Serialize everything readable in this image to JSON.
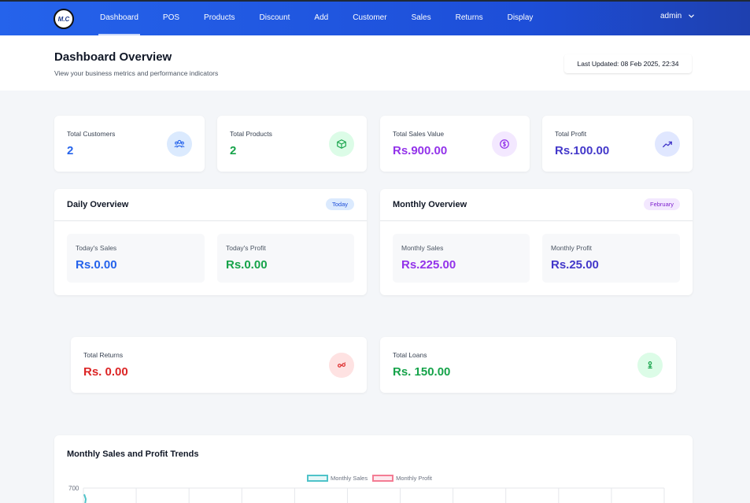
{
  "app": {
    "logo_text": "M.C",
    "nav": [
      {
        "label": "Dashboard",
        "active": true
      },
      {
        "label": "POS"
      },
      {
        "label": "Products"
      },
      {
        "label": "Discount"
      },
      {
        "label": "Add"
      },
      {
        "label": "Customer"
      },
      {
        "label": "Sales"
      },
      {
        "label": "Returns"
      },
      {
        "label": "Display"
      }
    ],
    "user": "admin"
  },
  "header": {
    "title": "Dashboard Overview",
    "subtitle": "View your business metrics and performance indicators",
    "last_updated": "Last Updated: 08 Feb 2025, 22:34"
  },
  "stats": [
    {
      "label": "Total Customers",
      "value": "2",
      "icon": "users-icon",
      "color": "#2563eb",
      "icon_bg": "#dbeafe"
    },
    {
      "label": "Total Products",
      "value": "2",
      "icon": "box-icon",
      "color": "#16a34a",
      "icon_bg": "#dcfce7"
    },
    {
      "label": "Total Sales Value",
      "value": "Rs.900.00",
      "icon": "dollar-icon",
      "color": "#9333ea",
      "icon_bg": "#f3e8ff"
    },
    {
      "label": "Total Profit",
      "value": "Rs.100.00",
      "icon": "trending-up-icon",
      "color": "#4338ca",
      "icon_bg": "#e0e7ff"
    }
  ],
  "daily": {
    "title": "Daily Overview",
    "badge": "Today",
    "items": [
      {
        "label": "Today's Sales",
        "value": "Rs.0.00",
        "color": "#2563eb"
      },
      {
        "label": "Today's Profit",
        "value": "Rs.0.00",
        "color": "#16a34a"
      }
    ]
  },
  "monthly": {
    "title": "Monthly Overview",
    "badge": "February",
    "items": [
      {
        "label": "Monthly Sales",
        "value": "Rs.225.00",
        "color": "#9333ea"
      },
      {
        "label": "Monthly Profit",
        "value": "Rs.25.00",
        "color": "#4338ca"
      }
    ]
  },
  "extra": [
    {
      "label": "Total Returns",
      "value": "Rs. 0.00",
      "icon": "link-icon",
      "color": "#dc2626",
      "icon_bg": "#fee2e2"
    },
    {
      "label": "Total Loans",
      "value": "Rs. 150.00",
      "icon": "loan-icon",
      "color": "#16a34a",
      "icon_bg": "#dcfce7"
    }
  ],
  "chart": {
    "title": "Monthly Sales and Profit Trends",
    "legend": [
      "Monthly Sales",
      "Monthly Profit"
    ],
    "y_top_label": "700"
  },
  "chart_data": {
    "type": "line",
    "title": "Monthly Sales and Profit Trends",
    "series": [
      {
        "name": "Monthly Sales",
        "color": "#4fc3c9"
      },
      {
        "name": "Monthly Profit",
        "color": "#f47c94"
      }
    ],
    "yticks_visible": [
      700
    ]
  }
}
